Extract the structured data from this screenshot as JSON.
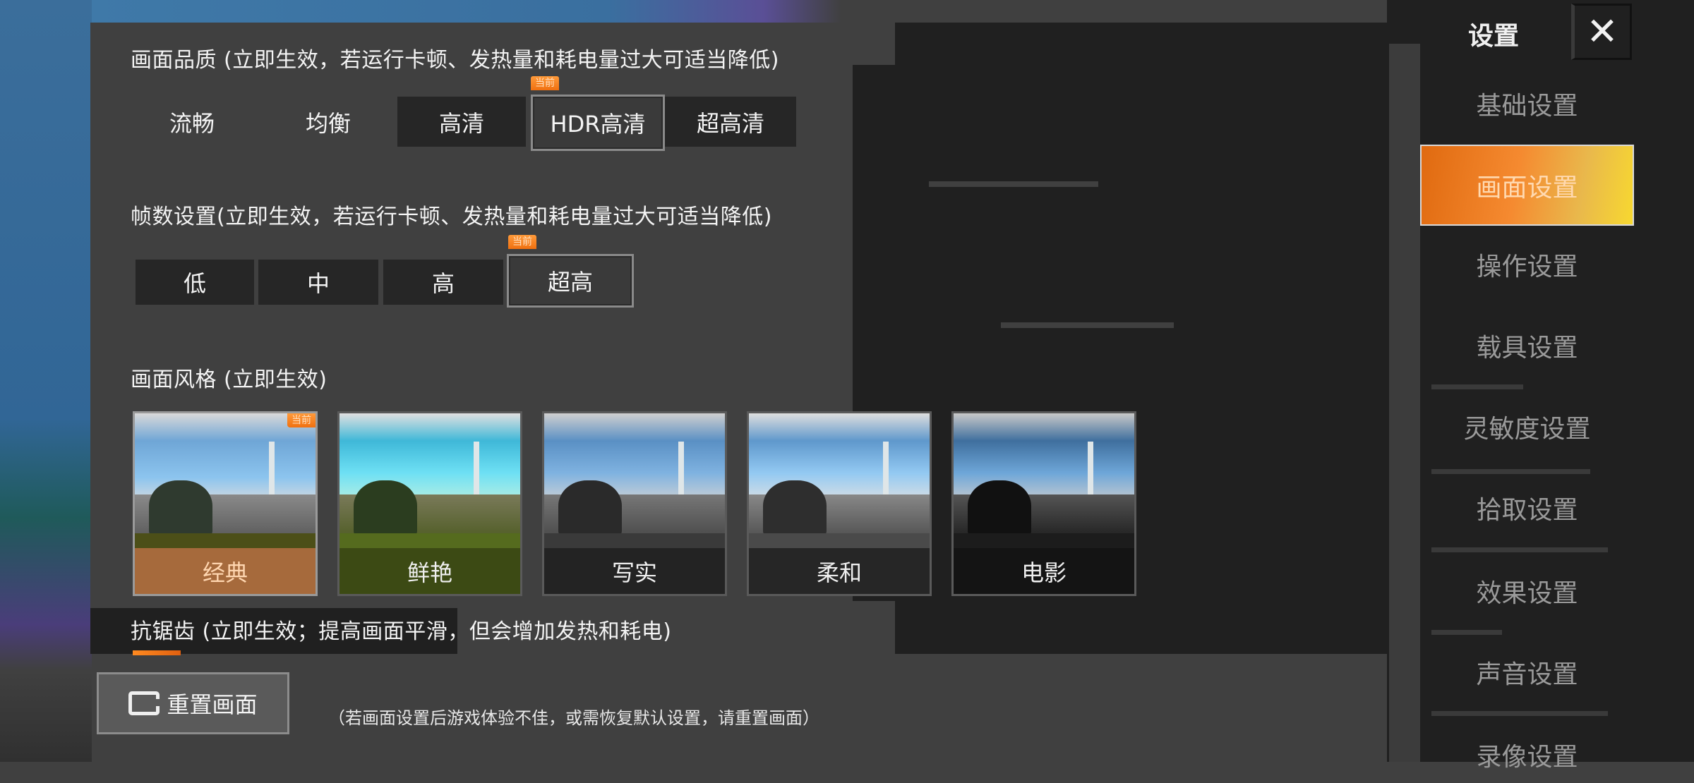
{
  "sidebar": {
    "title": "设置",
    "close_icon": "close-icon",
    "items": [
      {
        "label": "基础设置",
        "active": false
      },
      {
        "label": "画面设置",
        "active": true
      },
      {
        "label": "操作设置",
        "active": false
      },
      {
        "label": "载具设置",
        "active": false
      },
      {
        "label": "灵敏度设置",
        "active": false
      },
      {
        "label": "拾取设置",
        "active": false
      },
      {
        "label": "效果设置",
        "active": false
      },
      {
        "label": "声音设置",
        "active": false
      },
      {
        "label": "录像设置",
        "active": false
      }
    ]
  },
  "quality": {
    "label": "画面品质 (立即生效，若运行卡顿、发热量和耗电量过大可适当降低)",
    "badge": "当前",
    "options": [
      "流畅",
      "均衡",
      "高清",
      "HDR高清",
      "超高清"
    ],
    "selected": "HDR高清"
  },
  "framerate": {
    "label": "帧数设置(立即生效，若运行卡顿、发热量和耗电量过大可适当降低)",
    "badge": "当前",
    "options": [
      "低",
      "中",
      "高",
      "超高"
    ],
    "selected": "超高"
  },
  "style": {
    "label": "画面风格 (立即生效)",
    "badge": "当前",
    "options": [
      "经典",
      "鲜艳",
      "写实",
      "柔和",
      "电影"
    ],
    "selected": "经典"
  },
  "antialias": {
    "label": "抗锯齿 (立即生效；提高画面平滑，但会增加发热和耗电)"
  },
  "footer": {
    "reset_label": "重置画面",
    "reset_icon": "reset-frame-icon",
    "notice": "（若画面设置后游戏体验不佳，或需恢复默认设置，请重置画面）"
  },
  "colors": {
    "accent_orange": "#f58a30",
    "panel_bg": "#404040",
    "sidebar_bg": "#202020"
  }
}
